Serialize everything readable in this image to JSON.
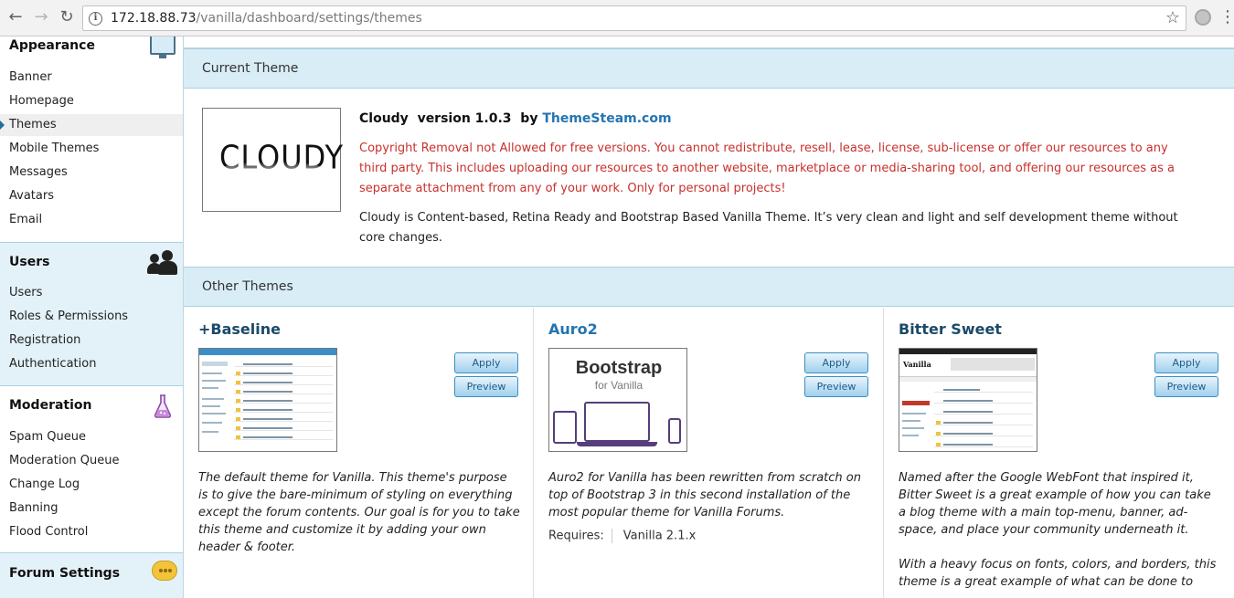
{
  "browser": {
    "url_host": "172.18.88.73",
    "url_path": "/vanilla/dashboard/settings/themes"
  },
  "sidebar": {
    "appearance": {
      "title": "Appearance",
      "items": [
        "Banner",
        "Homepage",
        "Themes",
        "Mobile Themes",
        "Messages",
        "Avatars",
        "Email"
      ],
      "active": "Themes"
    },
    "users": {
      "title": "Users",
      "items": [
        "Users",
        "Roles & Permissions",
        "Registration",
        "Authentication"
      ]
    },
    "moderation": {
      "title": "Moderation",
      "items": [
        "Spam Queue",
        "Moderation Queue",
        "Change Log",
        "Banning",
        "Flood Control"
      ]
    },
    "forum_settings": {
      "title": "Forum Settings"
    }
  },
  "current_theme": {
    "section_title": "Current Theme",
    "logo_text": "CLOUDY",
    "name": "Cloudy",
    "version": "version 1.0.3",
    "by": "by",
    "author": "ThemeSteam.com",
    "copyright": "Copyright Removal not Allowed for free versions. You cannot redistribute, resell, lease, license, sub-license or offer our resources to any third party. This includes uploading our resources to another website, marketplace or media-sharing tool, and offering our resources as a separate attachment from any of your work. Only for personal projects!",
    "description": "Cloudy is Content-based, Retina Ready and Bootstrap Based Vanilla Theme. It’s very clean and light and self development theme without core changes."
  },
  "other_themes": {
    "section_title": "Other Themes",
    "apply_label": "Apply",
    "preview_label": "Preview",
    "themes": [
      {
        "name": "+Baseline",
        "description": "The default theme for Vanilla. This theme's purpose is to give the bare-minimum of styling on everything except the forum contents. Our goal is for you to take this theme and customize it by adding your own header & footer."
      },
      {
        "name": "Auro2",
        "thumb_title": "Bootstrap",
        "thumb_subtitle": "for Vanilla",
        "description": "Auro2 for Vanilla has been rewritten from scratch on top of Bootstrap 3 in this second installation of the most popular theme for Vanilla Forums.",
        "requires_label": "Requires:",
        "requires_value": "Vanilla 2.1.x"
      },
      {
        "name": "Bitter Sweet",
        "thumb_logo": "Vanilla",
        "description": "Named after the Google WebFont that inspired it, Bitter Sweet is a great example of how you can take a blog theme with a main top-menu, banner, ad-space, and place your community underneath it.",
        "description_2": "With a heavy focus on fonts, colors, and borders, this theme is a great example of what can be done to"
      }
    ]
  }
}
